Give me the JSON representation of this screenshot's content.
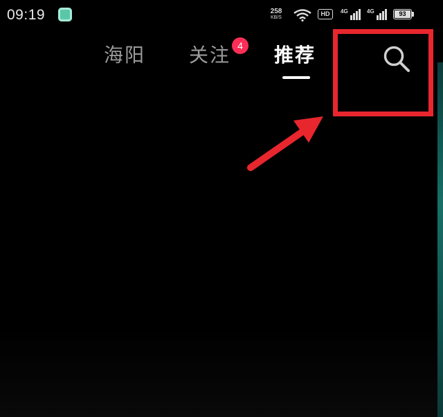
{
  "status_bar": {
    "time": "09:19",
    "net_speed_value": "258",
    "net_speed_unit": "KB/S",
    "hd_label": "HD",
    "signal1_label": "4G",
    "signal2_label": "4G",
    "battery_level": "93"
  },
  "tabs": [
    {
      "label": "海阳",
      "active": false
    },
    {
      "label": "关注",
      "active": false,
      "badge": "4"
    },
    {
      "label": "推荐",
      "active": true
    }
  ],
  "icons": {
    "app_icon": "app-notification-icon",
    "wifi": "wifi-icon",
    "search": "search-icon",
    "annotation_arrow": "arrow-icon"
  },
  "colors": {
    "background": "#000000",
    "active_tab": "#ffffff",
    "inactive_tab": "#9a9a9a",
    "badge": "#ff2e56",
    "annotation": "#e8262e"
  }
}
